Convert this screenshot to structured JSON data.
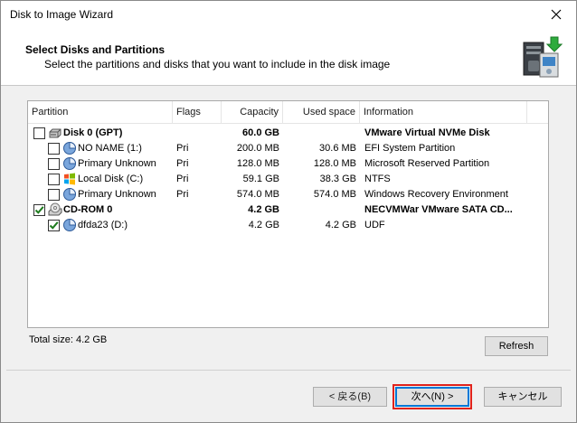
{
  "window": {
    "title": "Disk to Image Wizard"
  },
  "header": {
    "title": "Select Disks and Partitions",
    "subtitle": "Select the partitions and disks that you want to include in the disk image"
  },
  "columns": [
    "Partition",
    "Flags",
    "Capacity",
    "Used space",
    "Information"
  ],
  "rows": [
    {
      "checked": false,
      "indent": 0,
      "icon": "hard-disk-icon",
      "name": "Disk 0 (GPT)",
      "flags": "",
      "capacity": "60.0 GB",
      "used": "",
      "info": "VMware Virtual NVMe Disk",
      "bold": true
    },
    {
      "checked": false,
      "indent": 1,
      "icon": "partition-icon",
      "name": "NO NAME (1:)",
      "flags": "Pri",
      "capacity": "200.0 MB",
      "used": "30.6 MB",
      "info": "EFI System Partition",
      "bold": false
    },
    {
      "checked": false,
      "indent": 1,
      "icon": "partition-icon",
      "name": "Primary Unknown",
      "flags": "Pri",
      "capacity": "128.0 MB",
      "used": "128.0 MB",
      "info": "Microsoft Reserved Partition",
      "bold": false
    },
    {
      "checked": false,
      "indent": 1,
      "icon": "windows-partition-icon",
      "name": "Local Disk (C:)",
      "flags": "Pri",
      "capacity": "59.1 GB",
      "used": "38.3 GB",
      "info": "NTFS",
      "bold": false
    },
    {
      "checked": false,
      "indent": 1,
      "icon": "partition-icon",
      "name": "Primary Unknown",
      "flags": "Pri",
      "capacity": "574.0 MB",
      "used": "574.0 MB",
      "info": "Windows Recovery Environment",
      "bold": false
    },
    {
      "checked": true,
      "indent": 0,
      "icon": "cd-rom-icon",
      "name": "CD-ROM 0",
      "flags": "",
      "capacity": "4.2 GB",
      "used": "",
      "info": "NECVMWar VMware SATA CD...",
      "bold": true
    },
    {
      "checked": true,
      "indent": 1,
      "icon": "partition-icon",
      "name": "dfda23 (D:)",
      "flags": "",
      "capacity": "4.2 GB",
      "used": "4.2 GB",
      "info": "UDF",
      "bold": false
    }
  ],
  "footer": {
    "total_label": "Total size: 4.2 GB",
    "refresh": "Refresh",
    "back": "< 戻る(B)",
    "next": "次へ(N) >",
    "cancel": "キャンセル"
  },
  "colors": {
    "accent": "#0078d7",
    "highlight": "#e0231c",
    "check": "#1e7b1e"
  }
}
